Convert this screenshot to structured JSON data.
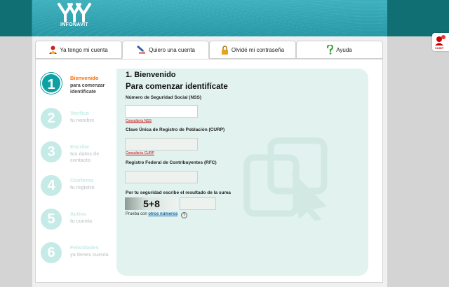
{
  "header": {
    "logo_text": "INFONAVIT"
  },
  "tabs": [
    {
      "label": "Ya tengo mi cuenta",
      "icon": "user-icon"
    },
    {
      "label": "Quiero una cuenta",
      "icon": "pencil-icon"
    },
    {
      "label": "Olvidé mi contraseña",
      "icon": "lock-icon"
    },
    {
      "label": "Ayuda",
      "icon": "question-icon"
    }
  ],
  "steps": [
    {
      "num": "1",
      "title": "Bienvenido",
      "sub": "para comenzar identifícate"
    },
    {
      "num": "2",
      "title": "Verifica",
      "sub": "tu nombre"
    },
    {
      "num": "3",
      "title": "Escribe",
      "sub": "tus datos de contacto"
    },
    {
      "num": "4",
      "title": "Confirma",
      "sub": "tu registro"
    },
    {
      "num": "5",
      "title": "Activa",
      "sub": "tu cuenta"
    },
    {
      "num": "6",
      "title": "Felicidades",
      "sub": "ya tienes cuenta"
    }
  ],
  "form": {
    "heading": "1. Bienvenido",
    "subheading": "Para comenzar identifícate",
    "nss_label": "Número de Seguridad Social (NSS)",
    "nss_hint": "Consulta tu NSS",
    "curp_label": "Clave Única de Registro de Población (CURP)",
    "curp_hint": "Consulta tu CURP",
    "rfc_label": "Registro Federal de Contribuyentes (RFC)",
    "captcha_label": "Por tu seguridad escribe el resultado de la suma",
    "captcha_value": "5+8",
    "try_prefix": "Prueba con",
    "try_link": "otros números",
    "help_symbol": "?"
  },
  "side_badge": {
    "label": "CUIDT",
    "icon": "chat-user-icon"
  },
  "colors": {
    "teal": "#0ea1a4",
    "accent_orange": "#ff6b00",
    "panel_bg": "#e1f2ef"
  }
}
